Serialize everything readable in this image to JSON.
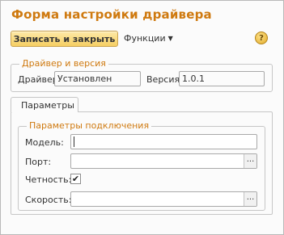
{
  "window": {
    "title": "Форма настройки драйвера"
  },
  "toolbar": {
    "save_label": "Записать и закрыть",
    "functions_label": "Функции",
    "help_glyph": "?"
  },
  "driver_group": {
    "title": "Драйвер и версия",
    "driver_label": "Драйвер:",
    "driver_value": "Установлен",
    "version_label": "Версия:",
    "version_value": "1.0.1"
  },
  "tabs": [
    {
      "label": "Параметры"
    }
  ],
  "connection_group": {
    "title": "Параметры подключения",
    "model_label": "Модель:",
    "model_value": "",
    "port_label": "Порт:",
    "port_value": "",
    "parity_label": "Четность:",
    "parity_checked": true,
    "speed_label": "Скорость:",
    "speed_value": "",
    "select_glyph": "..."
  },
  "colors": {
    "accent": "#cf7a10",
    "button_top": "#fde9a8",
    "button_bottom": "#f6cf63"
  }
}
